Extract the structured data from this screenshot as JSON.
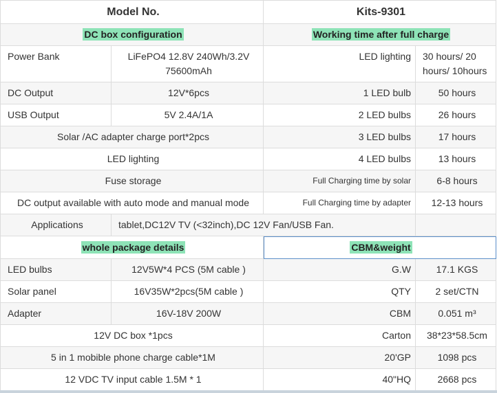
{
  "header": {
    "left": "Model No.",
    "right": "Kits-9301"
  },
  "sections": {
    "dc_box": "DC box configuration",
    "working_time": "Working time after full charge",
    "package": "whole package details",
    "cbm": "CBM&weight"
  },
  "rows1": {
    "power_bank_label": "Power Bank",
    "power_bank_value": "LiFePO4 12.8V 240Wh/3.2V 75600mAh",
    "led_lighting_label": "LED lighting",
    "led_lighting_value": "30 hours/ 20 hours/ 10hours",
    "dc_output_label": "DC Output",
    "dc_output_value": "12V*6pcs",
    "led1_label": "1 LED bulb",
    "led1_value": "50 hours",
    "usb_label": "USB Output",
    "usb_value": "5V  2.4A/1A",
    "led2_label": "2 LED bulbs",
    "led2_value": "26 hours",
    "solar_port": "Solar /AC adapter charge port*2pcs",
    "led3_label": "3 LED bulbs",
    "led3_value": "17 hours",
    "led_lighting2": "LED lighting",
    "led4_label": "4 LED bulbs",
    "led4_value": "13 hours",
    "fuse": "Fuse storage",
    "solar_charge_label": "Full Charging time by solar",
    "solar_charge_value": "6-8 hours",
    "dc_auto": "DC output available with auto mode and manual mode",
    "adapter_charge_label": "Full Charging time by adapter",
    "adapter_charge_value": "12-13 hours",
    "applications_label": "Applications",
    "applications_value": "tablet,DC12V TV (<32inch),DC 12V Fan/USB Fan."
  },
  "rows2": {
    "led_bulbs_label": "LED bulbs",
    "led_bulbs_value": "12V5W*4 PCS (5M cable )",
    "gw_label": "G.W",
    "gw_value": "17.1 KGS",
    "solar_panel_label": "Solar panel",
    "solar_panel_value": "16V35W*2pcs(5M cable )",
    "qty_label": "QTY",
    "qty_value": "2 set/CTN",
    "adapter_label": "Adapter",
    "adapter_value": "16V-18V 200W",
    "cbm_label": "CBM",
    "cbm_value": "0.051 m³",
    "dcbox": "12V DC box *1pcs",
    "carton_label": "Carton",
    "carton_value": "38*23*58.5cm",
    "phone_cable": "5 in 1 mobible phone charge cable*1M",
    "gp20_label": "20'GP",
    "gp20_value": "1098 pcs",
    "tv_cable": "12 VDC TV input cable 1.5M * 1",
    "hq40_label": "40\"HQ",
    "hq40_value": "2668 pcs"
  }
}
